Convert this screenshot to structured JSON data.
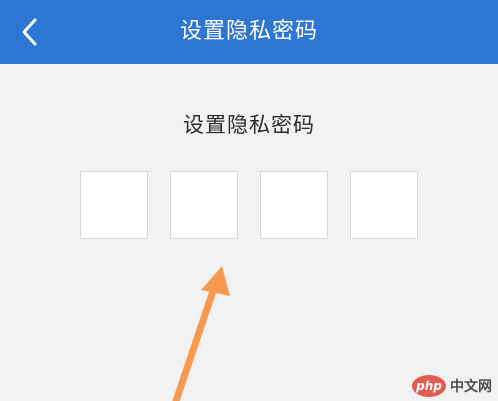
{
  "header": {
    "title": "设置隐私密码",
    "back_icon": "chevron-left-icon"
  },
  "main": {
    "prompt": "设置隐私密码",
    "pin_digits": [
      "",
      "",
      "",
      ""
    ]
  },
  "overlay": {
    "arrow_icon": "arrow-up-icon",
    "arrow_color": "#f79a4f"
  },
  "watermark": {
    "logo_text": "php",
    "site_text": "中文网"
  },
  "colors": {
    "header_bg": "#2d76d3",
    "page_bg": "#f2f2f2"
  }
}
